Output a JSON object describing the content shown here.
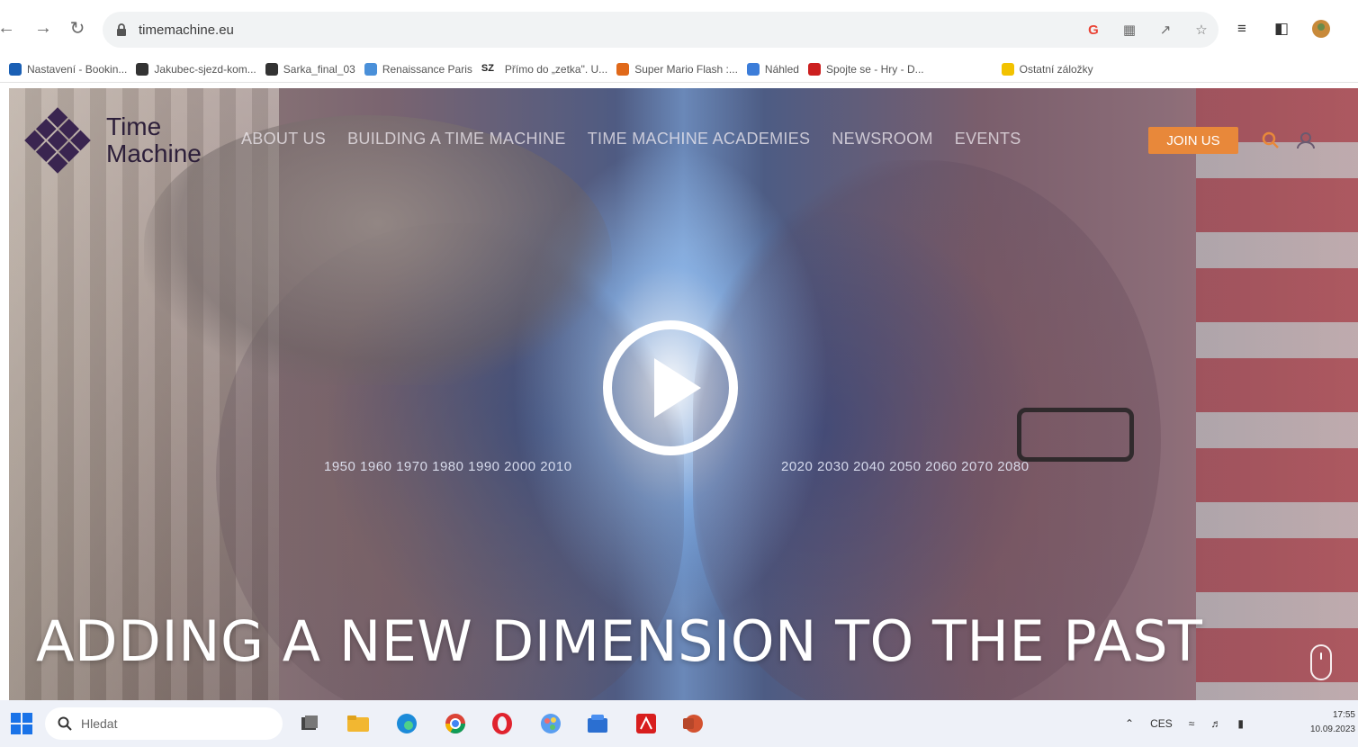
{
  "browser": {
    "url": "timemachine.eu",
    "bookmarks": [
      {
        "label": "Nastavení - Bookin...",
        "color": "#1a5fb4"
      },
      {
        "label": "Jakubec-sjezd-kom...",
        "color": "#333333"
      },
      {
        "label": "Sarka_final_03",
        "color": "#333333"
      },
      {
        "label": "Renaissance Paris",
        "color": "#4a90d9"
      },
      {
        "label": "Přímo do „zetka\". U...",
        "color": "#222222",
        "badge": "SZ"
      },
      {
        "label": "Super Mario Flash :...",
        "color": "#e0691a"
      },
      {
        "label": "Náhled",
        "color": "#3c7dd9"
      },
      {
        "label": "Spojte se - Hry - D...",
        "color": "#cc1f1f"
      },
      {
        "label": "Ostatní záložky",
        "color": "#f2c200"
      }
    ]
  },
  "site": {
    "logo": {
      "line1": "Time",
      "line2": "Machine"
    },
    "menu": [
      "ABOUT US",
      "BUILDING A TIME MACHINE",
      "TIME MACHINE ACADEMIES",
      "NEWSROOM",
      "EVENTS"
    ],
    "join_label": "JOIN US",
    "accent_color": "#e8883a",
    "hero": {
      "years_left": "1950 1960 1970 1980 1990 2000 2010",
      "years_right": "2020 2030 2040 2050 2060 2070 2080",
      "headline": "ADDING A NEW DIMENSION TO THE PAST"
    }
  },
  "taskbar": {
    "search_label": "Hledat",
    "language": "CES",
    "time": "17:55",
    "date": "10.09.2023"
  }
}
